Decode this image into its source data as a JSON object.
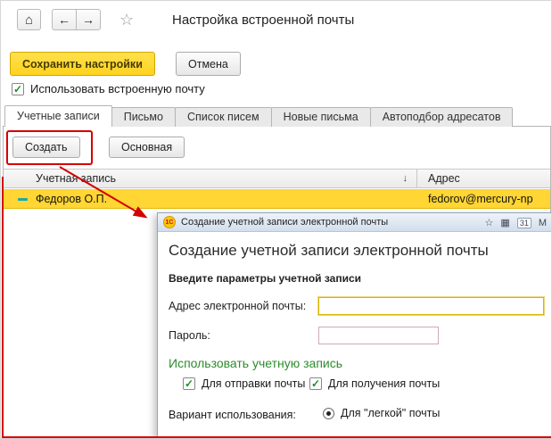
{
  "window": {
    "title": "Настройка встроенной почты"
  },
  "icons": {
    "home": "⌂",
    "back": "←",
    "forward": "→",
    "star": "☆",
    "check": "✓",
    "sort_down": "↓",
    "dlg_star": "☆",
    "dlg_grid": "▦",
    "dlg_calendar": "31",
    "dlg_menu": "М"
  },
  "actions": {
    "save": "Сохранить настройки",
    "cancel": "Отмена"
  },
  "use_mail": {
    "label": "Использовать встроенную почту",
    "checked": true
  },
  "tabs": [
    {
      "label": "Учетные записи",
      "active": true
    },
    {
      "label": "Письмо",
      "active": false
    },
    {
      "label": "Список писем",
      "active": false
    },
    {
      "label": "Новые письма",
      "active": false
    },
    {
      "label": "Автоподбор адресатов",
      "active": false
    }
  ],
  "list_toolbar": {
    "create": "Создать",
    "main": "Основная"
  },
  "table": {
    "columns": [
      {
        "label": "Учетная запись",
        "sort": "↓"
      },
      {
        "label": "Адрес"
      }
    ],
    "rows": [
      {
        "name": "Федоров О.П.",
        "address": "fedorov@mercury-np"
      }
    ]
  },
  "dialog": {
    "app_badge": "1С",
    "titlebar": "Создание учетной записи электронной почты",
    "heading": "Создание учетной записи электронной почты",
    "subtitle": "Введите параметры учетной записи",
    "fields": [
      {
        "label": "Адрес электронной почты:",
        "value": ""
      },
      {
        "label": "Пароль:",
        "value": ""
      }
    ],
    "section": {
      "title": "Использовать учетную запись",
      "checkboxes": [
        {
          "label": "Для отправки почты",
          "checked": true
        },
        {
          "label": "Для получения почты",
          "checked": true
        }
      ]
    },
    "usage": {
      "label": "Вариант использования:",
      "selected_option": "Для \"легкой\" почты"
    }
  },
  "colors": {
    "accent_yellow": "#FFD633",
    "selection_yellow": "#FFD633",
    "annotation_red": "#D40000",
    "green": "#2E8B2E",
    "titlebar_blue": "#D2DEED"
  }
}
